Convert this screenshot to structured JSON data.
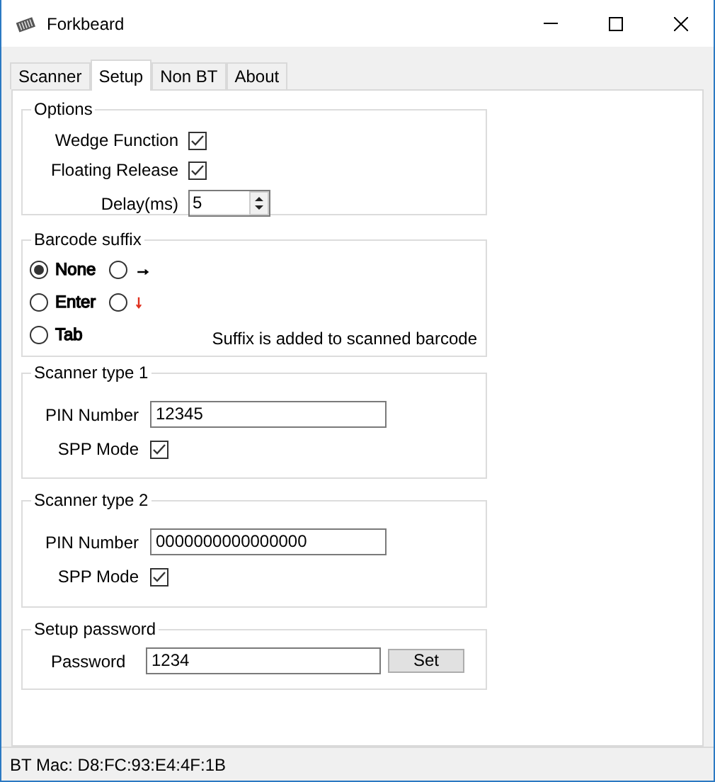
{
  "window": {
    "title": "Forkbeard"
  },
  "tabs": [
    {
      "label": "Scanner",
      "selected": false
    },
    {
      "label": "Setup",
      "selected": true
    },
    {
      "label": "Non BT",
      "selected": false
    },
    {
      "label": "About",
      "selected": false
    }
  ],
  "options": {
    "title": "Options",
    "checks": [
      {
        "label": "Wedge Function",
        "checked": true
      },
      {
        "label": "Floating Release",
        "checked": true
      }
    ],
    "delay": {
      "label": "Delay(ms)",
      "value": "5"
    }
  },
  "barcode_suffix": {
    "title": "Barcode suffix",
    "choices": [
      {
        "label": "None",
        "selected": true,
        "color": "#000000"
      },
      {
        "label": "→",
        "selected": false,
        "color": "#000000"
      },
      {
        "label": "Enter",
        "selected": false,
        "color": "#000000"
      },
      {
        "label": "↓",
        "selected": false,
        "color": "#e0301e"
      },
      {
        "label": "Tab",
        "selected": false,
        "color": "#000000"
      }
    ],
    "note": "Suffix is added to scanned barcode"
  },
  "scanners": [
    {
      "title": "Scanner type 1",
      "pin_label": "PIN Number",
      "pin_value": "12345",
      "spp_label": "SPP Mode",
      "spp_checked": true
    },
    {
      "title": "Scanner type 2",
      "pin_label": "PIN Number",
      "pin_value": "0000000000000000",
      "spp_label": "SPP Mode",
      "spp_checked": true
    }
  ],
  "setup_password": {
    "title": "Setup password",
    "label": "Password",
    "value": "1234",
    "button": "Set"
  },
  "status_bar": "BT Mac: D8:FC:93:E4:4F:1B"
}
